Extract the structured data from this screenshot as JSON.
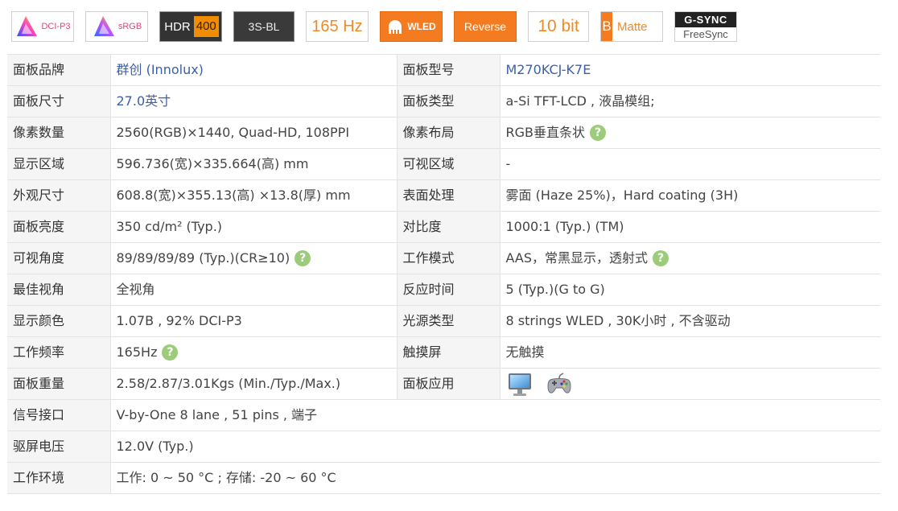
{
  "badges": {
    "dci_p3": "DCI-P3",
    "srgb": "sRGB",
    "hdr_left": "HDR",
    "hdr_right": "400",
    "backlight": "3S-BL",
    "refresh": "165 Hz",
    "wled": "WLED",
    "reverse": "Reverse",
    "bit_depth": "10 bit",
    "matte_mark": "B",
    "matte": "Matte",
    "gsync": "G-SYNC",
    "freesync": "FreeSync"
  },
  "rows": [
    {
      "k1": "面板品牌",
      "v1": "群创 (Innolux)",
      "k2": "面板型号",
      "v2": "M270KCJ-K7E"
    },
    {
      "k1": "面板尺寸",
      "v1": "27.0英寸",
      "k2": "面板类型",
      "v2": "a-Si TFT-LCD , 液晶模组;"
    },
    {
      "k1": "像素数量",
      "v1": "2560(RGB)×1440, Quad-HD, 108PPI",
      "k2": "像素布局",
      "v2": "RGB垂直条状"
    },
    {
      "k1": "显示区域",
      "v1": "596.736(宽)×335.664(高) mm",
      "k2": "可视区域",
      "v2": "-"
    },
    {
      "k1": "外观尺寸",
      "v1": "608.8(宽)×355.13(高) ×13.8(厚) mm",
      "k2": "表面处理",
      "v2": "雾面 (Haze 25%)，Hard coating (3H)"
    },
    {
      "k1": "面板亮度",
      "v1": "350 cd/m² (Typ.)",
      "k2": "对比度",
      "v2": "1000:1 (Typ.) (TM)"
    },
    {
      "k1": "可视角度",
      "v1": "89/89/89/89 (Typ.)(CR≥10)",
      "k2": "工作模式",
      "v2": "AAS，常黑显示，透射式"
    },
    {
      "k1": "最佳视角",
      "v1": "全视角",
      "k2": "反应时间",
      "v2": "5 (Typ.)(G to G)"
    },
    {
      "k1": "显示颜色",
      "v1": "1.07B , 92% DCI-P3",
      "k2": "光源类型",
      "v2": "8 strings WLED , 30K小时 , 不含驱动"
    },
    {
      "k1": "工作频率",
      "v1": "165Hz",
      "k2": "触摸屏",
      "v2": "无触摸"
    },
    {
      "k1": "面板重量",
      "v1": "2.58/2.87/3.01Kgs (Min./Typ./Max.)",
      "k2": "面板应用",
      "v2": ""
    }
  ],
  "full_rows": [
    {
      "k": "信号接口",
      "v": "V-by-One 8 lane , 51 pins , 端子"
    },
    {
      "k": "驱屏电压",
      "v": "12.0V (Typ.)"
    },
    {
      "k": "工作环境",
      "v": "工作: 0 ~ 50 °C ; 存储: -20 ~ 60 °C"
    }
  ],
  "help_mark": "?",
  "icons": {
    "application_1": "monitor-icon",
    "application_2": "gamepad-icon",
    "help": "help-circle-icon"
  }
}
